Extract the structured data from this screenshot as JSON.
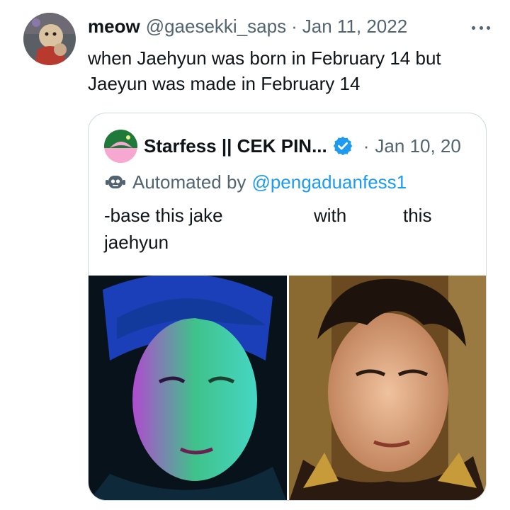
{
  "tweet": {
    "display_name": "meow",
    "handle": "@gaesekki_saps",
    "separator": "·",
    "date": "Jan 11, 2022",
    "text": "when Jaehyun was born in February 14 but Jaeyun was made in February 14"
  },
  "quote": {
    "display_name": "Starfess || CEK PIN...",
    "separator": "·",
    "date": "Jan 10, 20",
    "automated_label": "Automated by",
    "automated_account": "@pengaduanfess1",
    "text_words": [
      "-base this jake",
      "with",
      "this",
      "jaehyun"
    ]
  },
  "icons": {
    "more": "more-horizontal-icon",
    "verified": "verified-badge-icon",
    "automated": "robot-icon"
  },
  "colors": {
    "accent": "#1d9bf0",
    "secondary_text": "#536471",
    "border": "#cfd9de"
  }
}
